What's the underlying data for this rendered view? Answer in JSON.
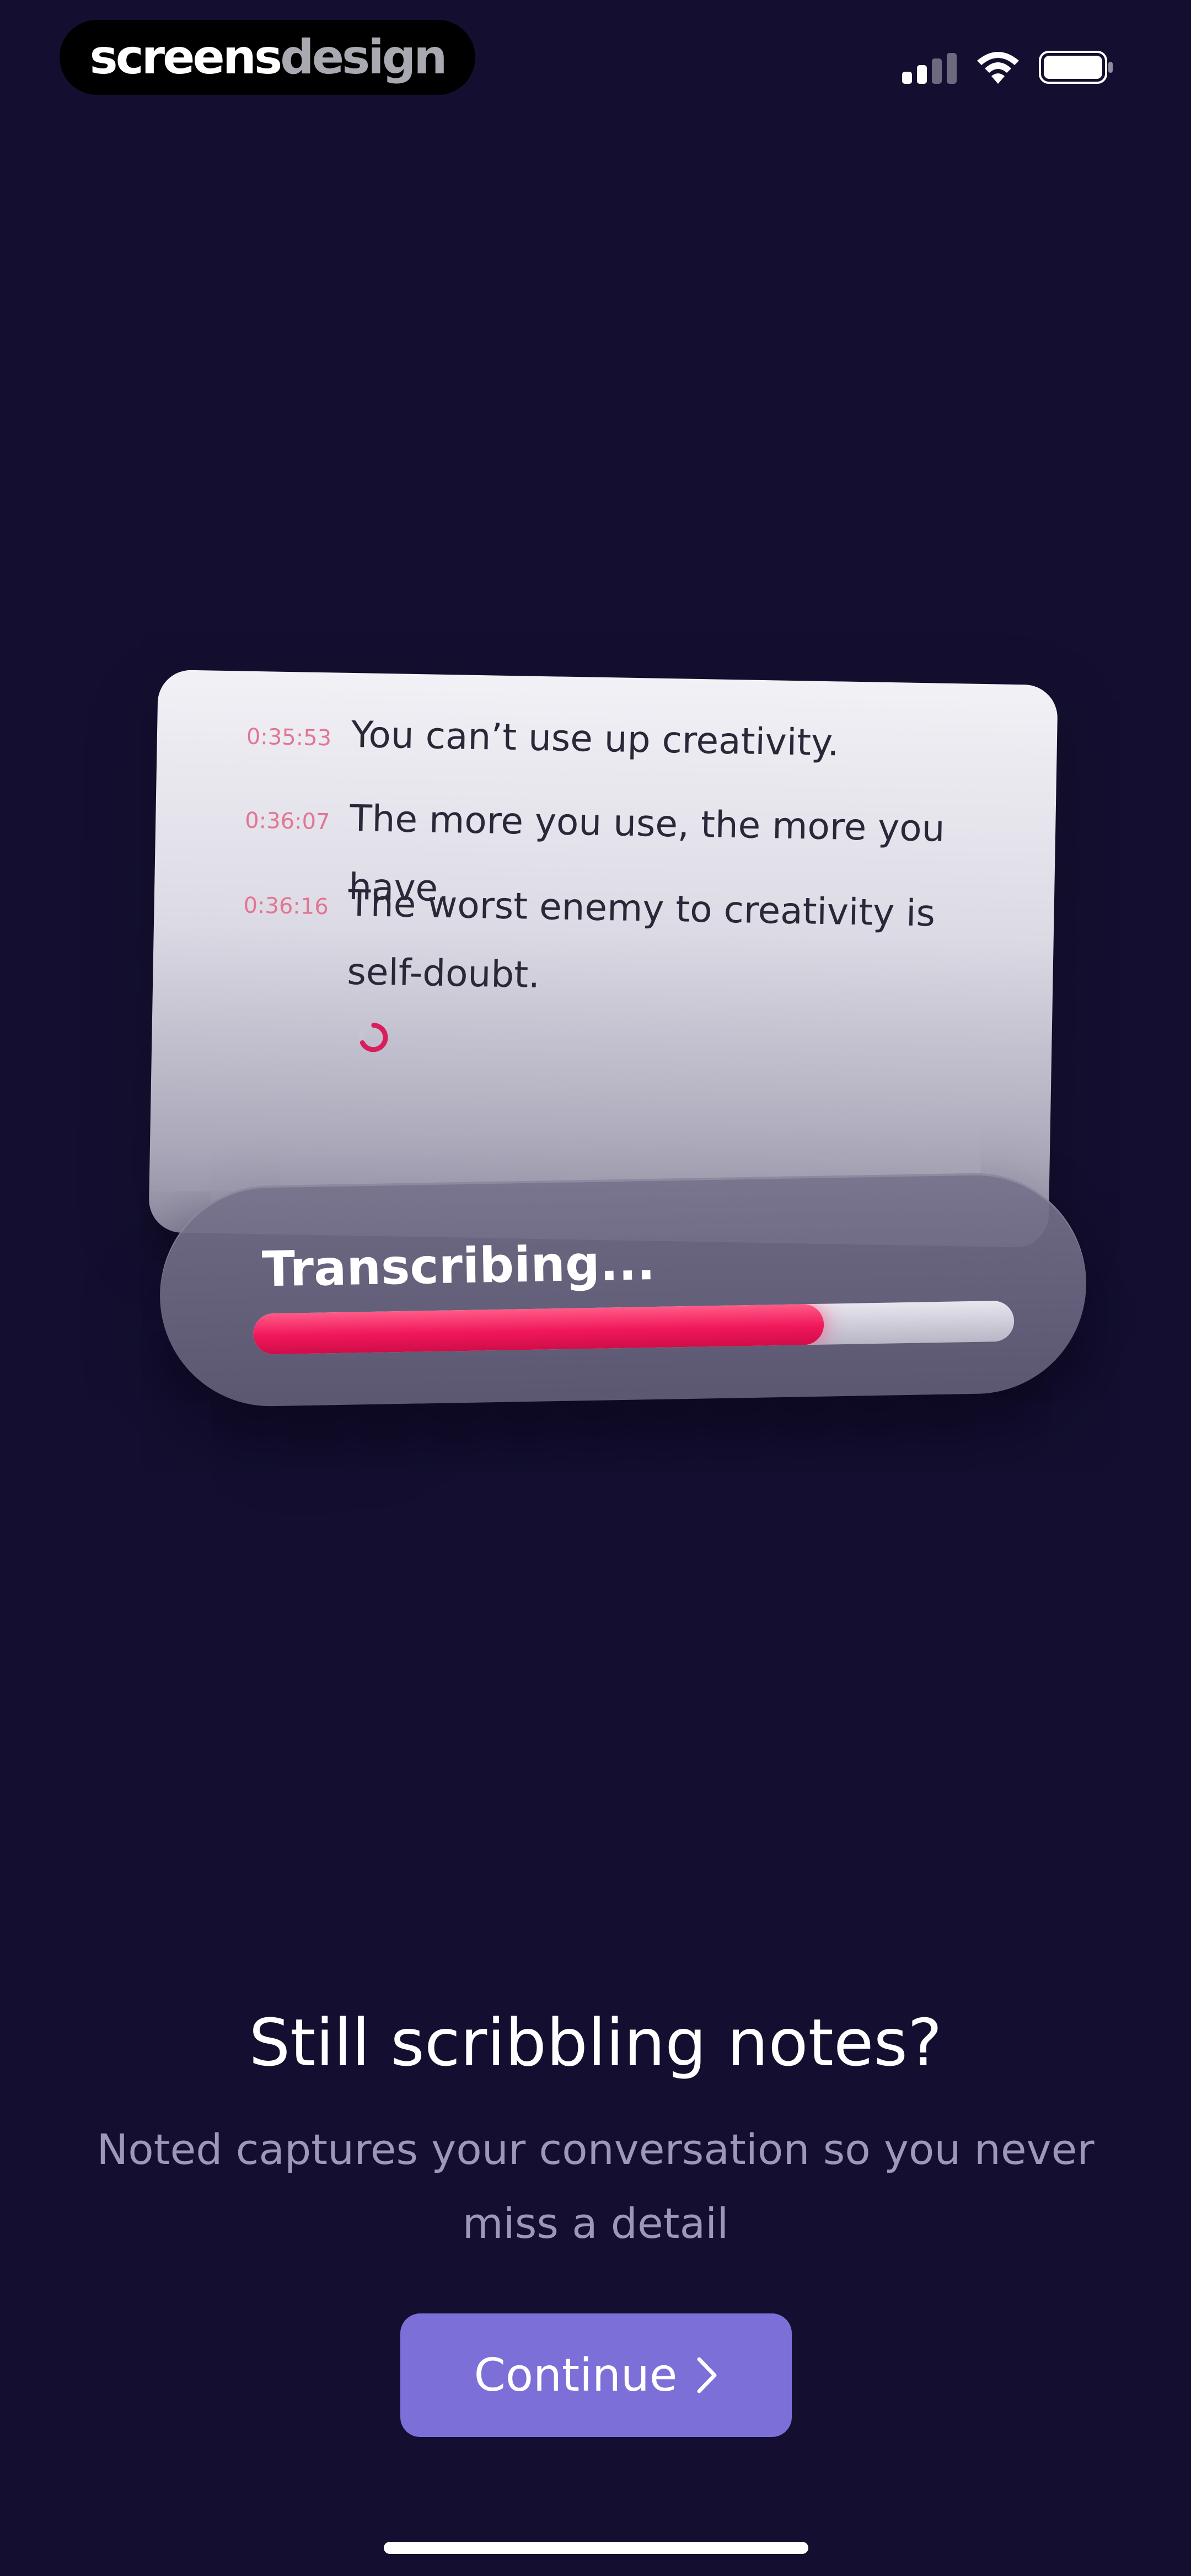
{
  "status_bar": {
    "brand_part1": "screens",
    "brand_part2": "design",
    "icons": [
      "cellular-signal-icon",
      "wifi-icon",
      "battery-icon"
    ],
    "signal_bars_active": 2,
    "signal_bars_total": 4
  },
  "transcript": {
    "lines": [
      {
        "time": "0:35:53",
        "text": "You can’t use up creativity."
      },
      {
        "time": "0:36:07",
        "text": "The more you use, the more you have."
      },
      {
        "time": "0:36:16",
        "text": "The worst enemy to creativity is self-doubt."
      }
    ],
    "loading_icon": "spinner-icon"
  },
  "progress": {
    "label": "Transcribing...",
    "value": 0.75
  },
  "onboarding": {
    "headline": "Still scribbling notes?",
    "subline": "Noted captures your conversation so you never miss a detail"
  },
  "cta": {
    "label": "Continue",
    "icon": "chevron-right-icon"
  },
  "colors": {
    "background": "#140f30",
    "accent": "#7d6fd8",
    "progress_fill": "#f0175a",
    "timestamp": "#e27592"
  }
}
